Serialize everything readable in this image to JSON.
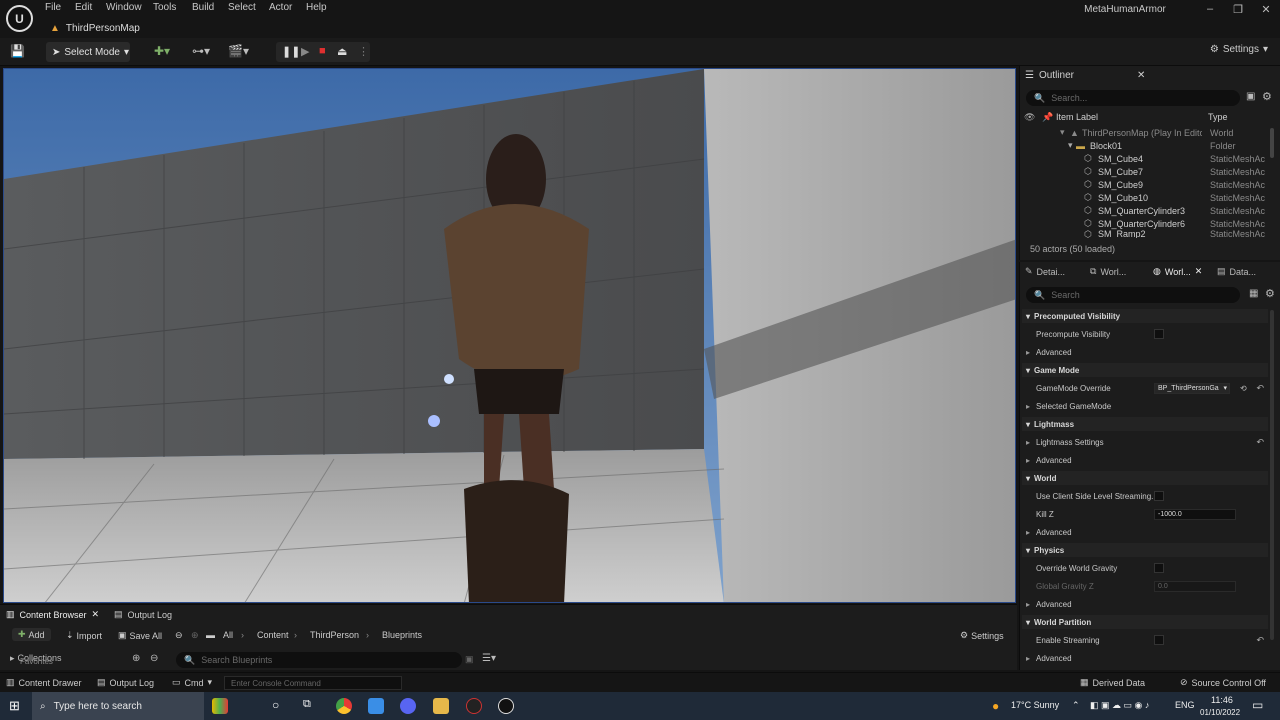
{
  "menu": {
    "items": [
      "File",
      "Edit",
      "Window",
      "Tools",
      "Build",
      "Select",
      "Actor",
      "Help"
    ],
    "project_name": "MetaHumanArmor",
    "map_tab": "ThirdPersonMap"
  },
  "toolbar": {
    "select_mode": "Select Mode",
    "settings": "Settings"
  },
  "outliner": {
    "tab": "Outliner",
    "search_placeholder": "Search...",
    "col_label": "Item Label",
    "col_type": "Type",
    "rows": [
      {
        "label": "ThirdPersonMap (Play In Editor)",
        "type": "World"
      },
      {
        "label": "Block01",
        "type": "Folder"
      },
      {
        "label": "SM_Cube4",
        "type": "StaticMeshAc"
      },
      {
        "label": "SM_Cube7",
        "type": "StaticMeshAc"
      },
      {
        "label": "SM_Cube9",
        "type": "StaticMeshAc"
      },
      {
        "label": "SM_Cube10",
        "type": "StaticMeshAc"
      },
      {
        "label": "SM_QuarterCylinder3",
        "type": "StaticMeshAc"
      },
      {
        "label": "SM_QuarterCylinder6",
        "type": "StaticMeshAc"
      },
      {
        "label": "SM_Ramp2",
        "type": "StaticMeshAc"
      }
    ],
    "actors_count": "50 actors (50 loaded)"
  },
  "details": {
    "tabs": [
      "Detai...",
      "Worl...",
      "Worl...",
      "Data..."
    ],
    "search_placeholder": "Search",
    "sections": {
      "precomputed": "Precomputed Visibility",
      "precompute_visibility": "Precompute Visibility",
      "advanced": "Advanced",
      "game_mode": "Game Mode",
      "gamemode_override": "GameMode Override",
      "gamemode_value": "BP_ThirdPersonGa",
      "selected_gamemode": "Selected GameMode",
      "lightmass": "Lightmass",
      "lightmass_settings": "Lightmass Settings",
      "world": "World",
      "use_client_side": "Use Client Side Level Streaming...",
      "kill_z": "Kill Z",
      "kill_z_value": "-1000.0",
      "physics": "Physics",
      "override_gravity": "Override World Gravity",
      "global_gravity": "Global Gravity Z",
      "global_gravity_value": "0.0",
      "world_partition": "World Partition",
      "enable_streaming": "Enable Streaming"
    }
  },
  "content_browser": {
    "tab": "Content Browser",
    "output_log_tab": "Output Log",
    "add": "Add",
    "import": "Import",
    "save_all": "Save All",
    "path": [
      "All",
      "Content",
      "ThirdPerson",
      "Blueprints"
    ],
    "settings": "Settings",
    "collections": "Collections",
    "favorites": "Favorites",
    "search_placeholder": "Search Blueprints"
  },
  "status_bar": {
    "content_drawer": "Content Drawer",
    "output_log": "Output Log",
    "cmd": "Cmd",
    "console_placeholder": "Enter Console Command",
    "derived_data": "Derived Data",
    "source_control": "Source Control Off"
  },
  "taskbar": {
    "search_placeholder": "Type here to search",
    "weather": "17°C  Sunny",
    "lang": "ENG",
    "time": "11:46",
    "date": "01/10/2022"
  }
}
